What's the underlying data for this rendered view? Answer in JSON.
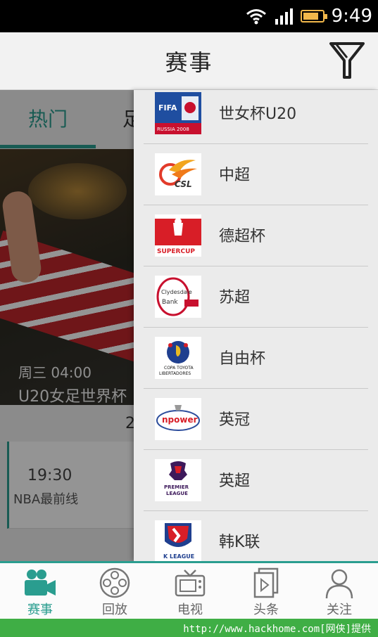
{
  "status_bar": {
    "time": "9:49",
    "icons": [
      "wifi-icon",
      "signal-icon",
      "battery-icon"
    ],
    "background": "#000000"
  },
  "header": {
    "title": "赛事",
    "filter_icon": "filter-funnel-icon"
  },
  "background_content": {
    "tabs": [
      {
        "label": "热门",
        "active": true
      },
      {
        "label": "足"
      }
    ],
    "banner": {
      "time": "周三 04:00",
      "title": "U20女足世界杯"
    },
    "date_partial": "2",
    "match": {
      "time": "19:30",
      "name": "NBA最前线"
    }
  },
  "drawer": {
    "leagues": [
      {
        "name": "世女杯U20",
        "logo": "fifa-u20-womens-logo",
        "logo_text": "FIFA"
      },
      {
        "name": "中超",
        "logo": "csl-logo",
        "logo_text": "CSL"
      },
      {
        "name": "德超杯",
        "logo": "supercup-logo",
        "logo_text": "SUPERCUP"
      },
      {
        "name": "苏超",
        "logo": "clydesdale-bank-premier-league-logo",
        "logo_text": "Clydesdale Bank"
      },
      {
        "name": "自由杯",
        "logo": "copa-libertadores-logo",
        "logo_text": "COPA TOYOTA LIBERTADORES"
      },
      {
        "name": "英冠",
        "logo": "npower-championship-logo",
        "logo_text": "npower"
      },
      {
        "name": "英超",
        "logo": "premier-league-logo",
        "logo_text": "PREMIER LEAGUE"
      },
      {
        "name": "韩K联",
        "logo": "k-league-logo",
        "logo_text": "K LEAGUE"
      }
    ]
  },
  "bottom_nav": [
    {
      "label": "赛事",
      "icon": "video-camera-icon",
      "active": true
    },
    {
      "label": "回放",
      "icon": "film-reel-icon"
    },
    {
      "label": "电视",
      "icon": "tv-icon"
    },
    {
      "label": "头条",
      "icon": "play-document-icon"
    },
    {
      "label": "关注",
      "icon": "person-icon"
    }
  ],
  "watermark": "http://www.hackhome.com[网侠]提供",
  "colors": {
    "accent": "#2a9d8f",
    "watermark_bar": "#3fae45",
    "battery": "#f2b84b"
  }
}
